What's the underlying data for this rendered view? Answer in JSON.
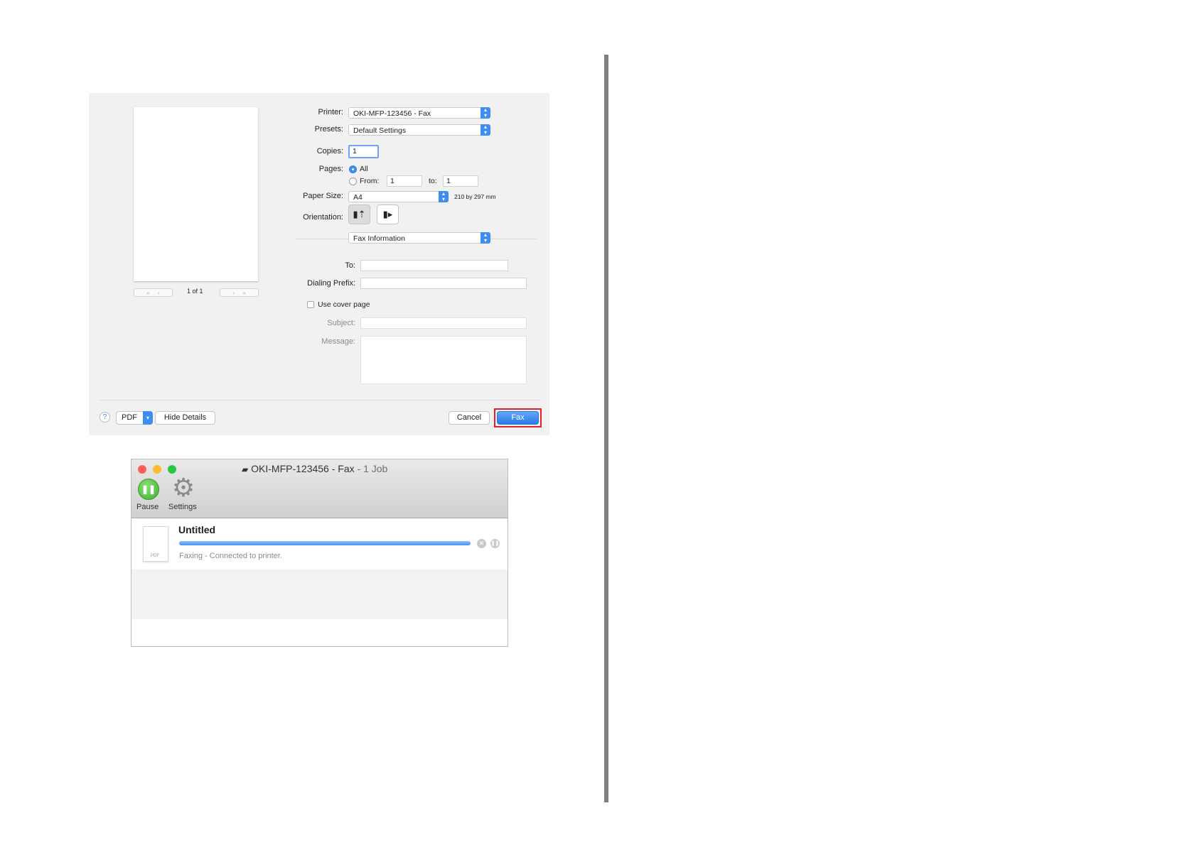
{
  "print_dialog": {
    "printer": {
      "label": "Printer:",
      "value": "OKI-MFP-123456 - Fax"
    },
    "presets": {
      "label": "Presets:",
      "value": "Default Settings"
    },
    "copies": {
      "label": "Copies:",
      "value": "1"
    },
    "pages": {
      "label": "Pages:",
      "all_label": "All",
      "from_label": "From:",
      "from_value": "1",
      "to_label": "to:",
      "to_value": "1",
      "selected": "All"
    },
    "paper_size": {
      "label": "Paper Size:",
      "value": "A4",
      "dimensions": "210 by 297 mm"
    },
    "orientation": {
      "label": "Orientation:",
      "portrait_icon": "portrait-orientation-icon",
      "landscape_icon": "landscape-orientation-icon",
      "selected": "portrait"
    },
    "section": {
      "value": "Fax Information"
    },
    "fax": {
      "to_label": "To:",
      "to_value": "",
      "dialing_prefix_label": "Dialing Prefix:",
      "dialing_prefix_value": "",
      "cover_page_label": "Use cover page",
      "cover_page_checked": false,
      "subject_label": "Subject:",
      "subject_value": "",
      "message_label": "Message:",
      "message_value": ""
    },
    "preview": {
      "page_indicator": "1 of 1",
      "first_label": "«",
      "prev_label": "‹",
      "next_label": "›",
      "last_label": "»"
    },
    "footer": {
      "help_label": "?",
      "pdf_label": "PDF",
      "hide_details_label": "Hide Details",
      "cancel_label": "Cancel",
      "fax_label": "Fax"
    },
    "colors": {
      "accent": "#3d8ef3",
      "highlight_border": "#e0202a"
    }
  },
  "queue_window": {
    "title": "OKI-MFP-123456 - Fax",
    "subtitle": "- 1 Job",
    "toolbar": {
      "pause_label": "Pause",
      "settings_label": "Settings"
    },
    "job": {
      "name": "Untitled",
      "status": "Faxing - Connected to printer.",
      "progress": 1.0,
      "file_badge": "PDF"
    },
    "traffic_colors": {
      "close": "#fc5f57",
      "minimize": "#fdbc2e",
      "zoom": "#28c840"
    }
  }
}
